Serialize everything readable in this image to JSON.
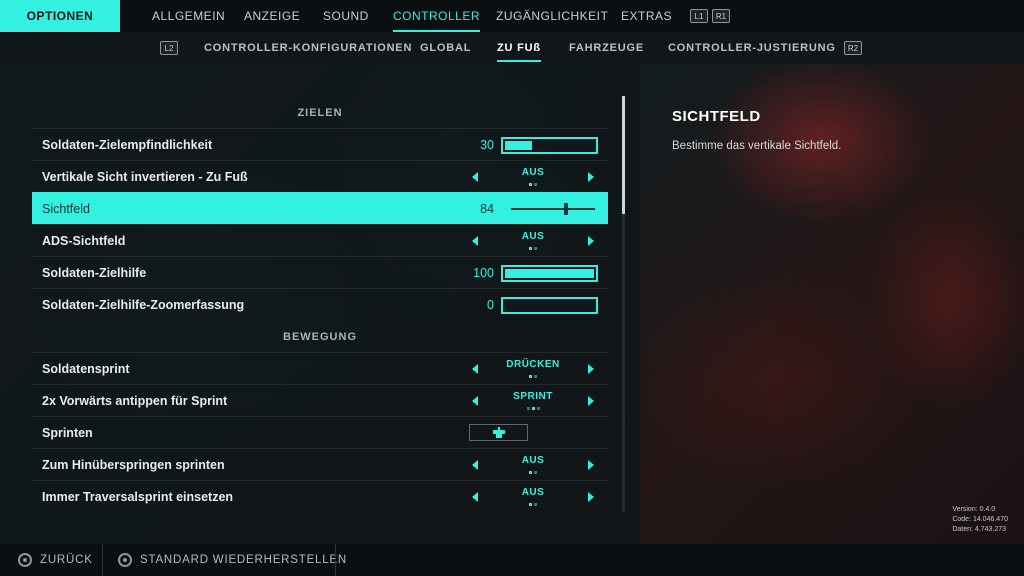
{
  "colors": {
    "accent": "#33f0e0",
    "selected_text": "#0b3b38",
    "background": "#0d1215"
  },
  "top_nav": {
    "title": "OPTIONEN",
    "tabs": [
      "ALLGEMEIN",
      "ANZEIGE",
      "SOUND",
      "CONTROLLER",
      "ZUGÄNGLICHKEIT",
      "EXTRAS"
    ],
    "active_tab": "CONTROLLER",
    "left_bumper": "L1",
    "right_bumper": "R1"
  },
  "sub_nav": {
    "left_trigger": "L2",
    "tabs": [
      "CONTROLLER-KONFIGURATIONEN",
      "GLOBAL",
      "ZU FUß",
      "FAHRZEUGE",
      "CONTROLLER-JUSTIERUNG"
    ],
    "active_tab": "ZU FUß",
    "right_trigger": "R2"
  },
  "sections": {
    "aim": "ZIELEN",
    "movement": "BEWEGUNG"
  },
  "settings": [
    {
      "label": "Soldaten-Zielempfindlichkeit",
      "type": "bar",
      "value": "30",
      "fill_fraction": 0.3
    },
    {
      "label": "Vertikale Sicht invertieren - Zu Fuß",
      "type": "choice",
      "value": "AUS",
      "option_count": 2,
      "option_index": 0
    },
    {
      "label": "Sichtfeld",
      "type": "slider",
      "value": "84",
      "fill_fraction": 0.65,
      "selected": true
    },
    {
      "label": "ADS-Sichtfeld",
      "type": "choice",
      "value": "AUS",
      "option_count": 2,
      "option_index": 0
    },
    {
      "label": "Soldaten-Zielhilfe",
      "type": "bar",
      "value": "100",
      "fill_fraction": 1.0
    },
    {
      "label": "Soldaten-Zielhilfe-Zoomerfassung",
      "type": "bar",
      "value": "0",
      "fill_fraction": 0.0
    },
    {
      "label": "Soldatensprint",
      "type": "choice",
      "value": "DRÜCKEN",
      "option_count": 2,
      "option_index": 0
    },
    {
      "label": "2x Vorwärts antippen für Sprint",
      "type": "choice",
      "value": "SPRINT",
      "option_count": 3,
      "option_index": 1
    },
    {
      "label": "Sprinten",
      "type": "keybind",
      "icon": "controller-button-icon"
    },
    {
      "label": "Zum Hinüberspringen sprinten",
      "type": "choice",
      "value": "AUS",
      "option_count": 2,
      "option_index": 0
    },
    {
      "label": "Immer Traversalsprint einsetzen",
      "type": "choice",
      "value": "AUS",
      "option_count": 2,
      "option_index": 0
    }
  ],
  "scroll": {
    "position_fraction": 0.0,
    "visible_fraction": 0.28
  },
  "info": {
    "title": "SICHTFELD",
    "description": "Bestimme das vertikale Sichtfeld."
  },
  "version_info": [
    "Version: 0.4.0",
    "Code: 14.046.470",
    "Daten: 4.743.273"
  ],
  "footer": {
    "back_label": "ZURÜCK",
    "reset_label": "STANDARD WIEDERHERSTELLEN"
  }
}
